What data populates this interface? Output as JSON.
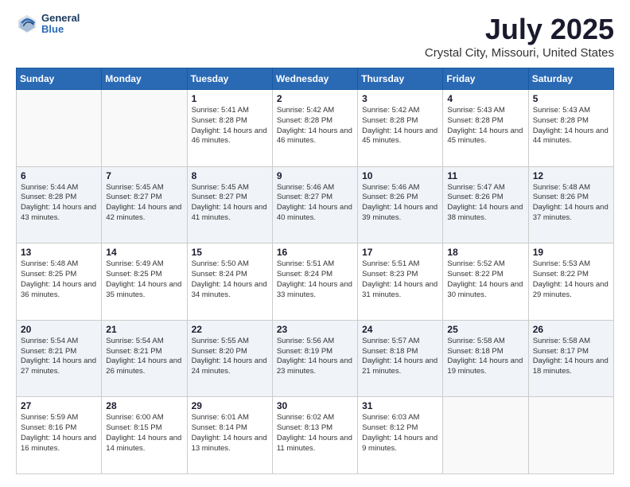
{
  "header": {
    "logo_line1": "General",
    "logo_line2": "Blue",
    "title": "July 2025",
    "subtitle": "Crystal City, Missouri, United States"
  },
  "calendar": {
    "headers": [
      "Sunday",
      "Monday",
      "Tuesday",
      "Wednesday",
      "Thursday",
      "Friday",
      "Saturday"
    ],
    "weeks": [
      [
        {
          "day": "",
          "info": ""
        },
        {
          "day": "",
          "info": ""
        },
        {
          "day": "1",
          "info": "Sunrise: 5:41 AM\nSunset: 8:28 PM\nDaylight: 14 hours and 46 minutes."
        },
        {
          "day": "2",
          "info": "Sunrise: 5:42 AM\nSunset: 8:28 PM\nDaylight: 14 hours and 46 minutes."
        },
        {
          "day": "3",
          "info": "Sunrise: 5:42 AM\nSunset: 8:28 PM\nDaylight: 14 hours and 45 minutes."
        },
        {
          "day": "4",
          "info": "Sunrise: 5:43 AM\nSunset: 8:28 PM\nDaylight: 14 hours and 45 minutes."
        },
        {
          "day": "5",
          "info": "Sunrise: 5:43 AM\nSunset: 8:28 PM\nDaylight: 14 hours and 44 minutes."
        }
      ],
      [
        {
          "day": "6",
          "info": "Sunrise: 5:44 AM\nSunset: 8:28 PM\nDaylight: 14 hours and 43 minutes."
        },
        {
          "day": "7",
          "info": "Sunrise: 5:45 AM\nSunset: 8:27 PM\nDaylight: 14 hours and 42 minutes."
        },
        {
          "day": "8",
          "info": "Sunrise: 5:45 AM\nSunset: 8:27 PM\nDaylight: 14 hours and 41 minutes."
        },
        {
          "day": "9",
          "info": "Sunrise: 5:46 AM\nSunset: 8:27 PM\nDaylight: 14 hours and 40 minutes."
        },
        {
          "day": "10",
          "info": "Sunrise: 5:46 AM\nSunset: 8:26 PM\nDaylight: 14 hours and 39 minutes."
        },
        {
          "day": "11",
          "info": "Sunrise: 5:47 AM\nSunset: 8:26 PM\nDaylight: 14 hours and 38 minutes."
        },
        {
          "day": "12",
          "info": "Sunrise: 5:48 AM\nSunset: 8:26 PM\nDaylight: 14 hours and 37 minutes."
        }
      ],
      [
        {
          "day": "13",
          "info": "Sunrise: 5:48 AM\nSunset: 8:25 PM\nDaylight: 14 hours and 36 minutes."
        },
        {
          "day": "14",
          "info": "Sunrise: 5:49 AM\nSunset: 8:25 PM\nDaylight: 14 hours and 35 minutes."
        },
        {
          "day": "15",
          "info": "Sunrise: 5:50 AM\nSunset: 8:24 PM\nDaylight: 14 hours and 34 minutes."
        },
        {
          "day": "16",
          "info": "Sunrise: 5:51 AM\nSunset: 8:24 PM\nDaylight: 14 hours and 33 minutes."
        },
        {
          "day": "17",
          "info": "Sunrise: 5:51 AM\nSunset: 8:23 PM\nDaylight: 14 hours and 31 minutes."
        },
        {
          "day": "18",
          "info": "Sunrise: 5:52 AM\nSunset: 8:22 PM\nDaylight: 14 hours and 30 minutes."
        },
        {
          "day": "19",
          "info": "Sunrise: 5:53 AM\nSunset: 8:22 PM\nDaylight: 14 hours and 29 minutes."
        }
      ],
      [
        {
          "day": "20",
          "info": "Sunrise: 5:54 AM\nSunset: 8:21 PM\nDaylight: 14 hours and 27 minutes."
        },
        {
          "day": "21",
          "info": "Sunrise: 5:54 AM\nSunset: 8:21 PM\nDaylight: 14 hours and 26 minutes."
        },
        {
          "day": "22",
          "info": "Sunrise: 5:55 AM\nSunset: 8:20 PM\nDaylight: 14 hours and 24 minutes."
        },
        {
          "day": "23",
          "info": "Sunrise: 5:56 AM\nSunset: 8:19 PM\nDaylight: 14 hours and 23 minutes."
        },
        {
          "day": "24",
          "info": "Sunrise: 5:57 AM\nSunset: 8:18 PM\nDaylight: 14 hours and 21 minutes."
        },
        {
          "day": "25",
          "info": "Sunrise: 5:58 AM\nSunset: 8:18 PM\nDaylight: 14 hours and 19 minutes."
        },
        {
          "day": "26",
          "info": "Sunrise: 5:58 AM\nSunset: 8:17 PM\nDaylight: 14 hours and 18 minutes."
        }
      ],
      [
        {
          "day": "27",
          "info": "Sunrise: 5:59 AM\nSunset: 8:16 PM\nDaylight: 14 hours and 16 minutes."
        },
        {
          "day": "28",
          "info": "Sunrise: 6:00 AM\nSunset: 8:15 PM\nDaylight: 14 hours and 14 minutes."
        },
        {
          "day": "29",
          "info": "Sunrise: 6:01 AM\nSunset: 8:14 PM\nDaylight: 14 hours and 13 minutes."
        },
        {
          "day": "30",
          "info": "Sunrise: 6:02 AM\nSunset: 8:13 PM\nDaylight: 14 hours and 11 minutes."
        },
        {
          "day": "31",
          "info": "Sunrise: 6:03 AM\nSunset: 8:12 PM\nDaylight: 14 hours and 9 minutes."
        },
        {
          "day": "",
          "info": ""
        },
        {
          "day": "",
          "info": ""
        }
      ]
    ]
  }
}
